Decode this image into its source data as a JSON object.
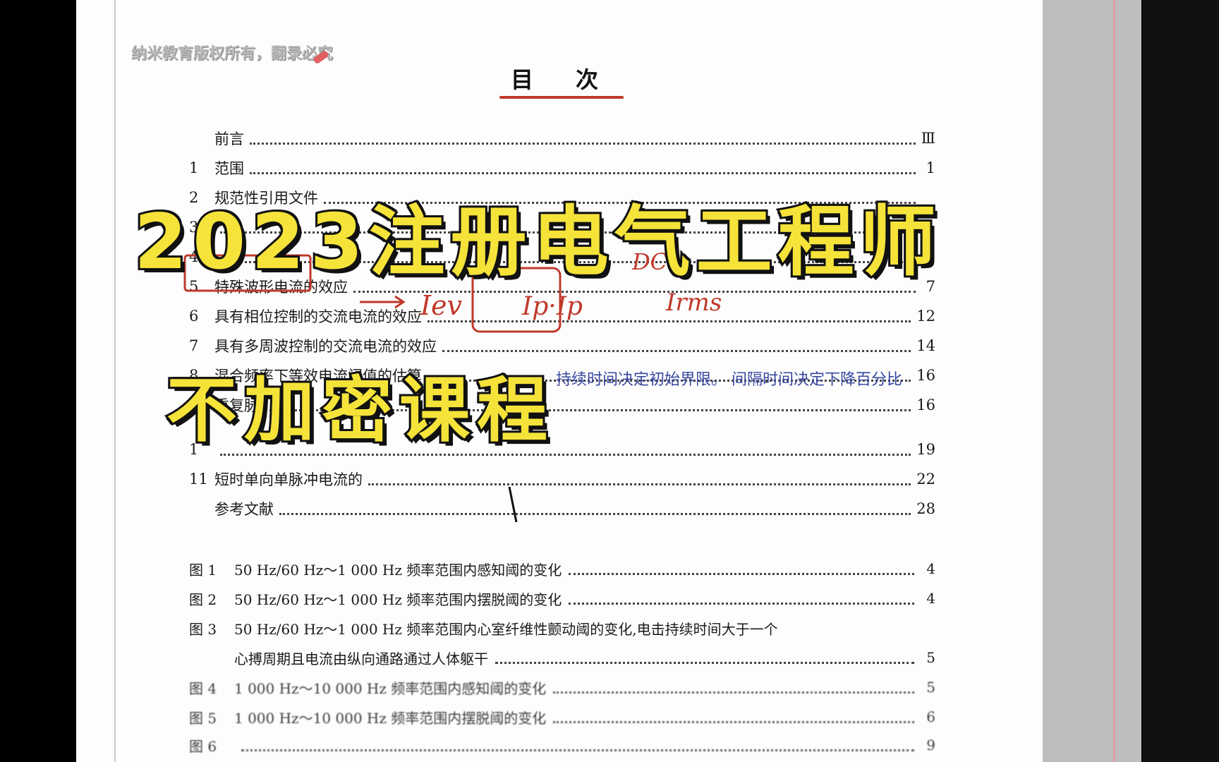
{
  "watermark": "纳米教育版权所有，翻录必究",
  "toc": {
    "title": "目次",
    "entries": [
      {
        "num": "",
        "label": "前言",
        "page": "Ⅲ"
      },
      {
        "num": "1",
        "label": "范围",
        "page": "1"
      },
      {
        "num": "2",
        "label": "规范性引用文件",
        "page": ""
      },
      {
        "num": "3",
        "label": "",
        "page": "1"
      },
      {
        "num": "4",
        "label": "",
        "page": ""
      },
      {
        "num": "5",
        "label": "特殊波形电流的效应",
        "page": "7"
      },
      {
        "num": "6",
        "label": "具有相位控制的交流电流的效应",
        "page": "12"
      },
      {
        "num": "7",
        "label": "具有多周波控制的交流电流的效应",
        "page": "14"
      },
      {
        "num": "8",
        "label": "混合频率下等效电流阈值的估算",
        "page": "16"
      },
      {
        "num": "9",
        "label": "重复脉",
        "page": "16"
      },
      {
        "num": "1",
        "label": "",
        "page": "19"
      },
      {
        "num": "11",
        "label": "短时单向单脉冲电流的",
        "page": "22"
      },
      {
        "num": "",
        "label": "参考文献",
        "page": "28"
      }
    ],
    "figures": [
      {
        "num": "图 1",
        "label": "50 Hz/60 Hz～1 000 Hz 频率范围内感知阈的变化",
        "page": "4"
      },
      {
        "num": "图 2",
        "label": "50 Hz/60 Hz～1 000 Hz 频率范围内摆脱阈的变化",
        "page": "4"
      },
      {
        "num": "图 3",
        "label": "50 Hz/60 Hz～1 000 Hz 频率范围内心室纤维性颤动阈的变化,电击持续时间大于一个",
        "page": ""
      },
      {
        "num": "",
        "label": "心搏周期且电流由纵向通路通过人体躯干",
        "page": "5"
      },
      {
        "num": "图 4",
        "label": "1 000 Hz～10 000 Hz 频率范围内感知阈的变化",
        "page": "5"
      },
      {
        "num": "图 5",
        "label": "1 000 Hz～10 000 Hz 频率范围内摆脱阈的变化",
        "page": "6"
      },
      {
        "num": "图 6",
        "label": "",
        "page": "9"
      }
    ]
  },
  "annotations": {
    "handwritten_blue": "持续时间决定初始界限。 间隔时间决定下降百分比",
    "handwritten_red": [
      "Iev",
      "Ip·Ip",
      "Irms",
      "DC"
    ]
  },
  "overlay": {
    "title": "2023注册电气工程师",
    "subtitle": "不加密课程"
  },
  "colors": {
    "overlay_text": "#f5e33a",
    "overlay_outline": "#111111",
    "annotation_red": "#c0392b",
    "annotation_blue": "#3848a0"
  }
}
